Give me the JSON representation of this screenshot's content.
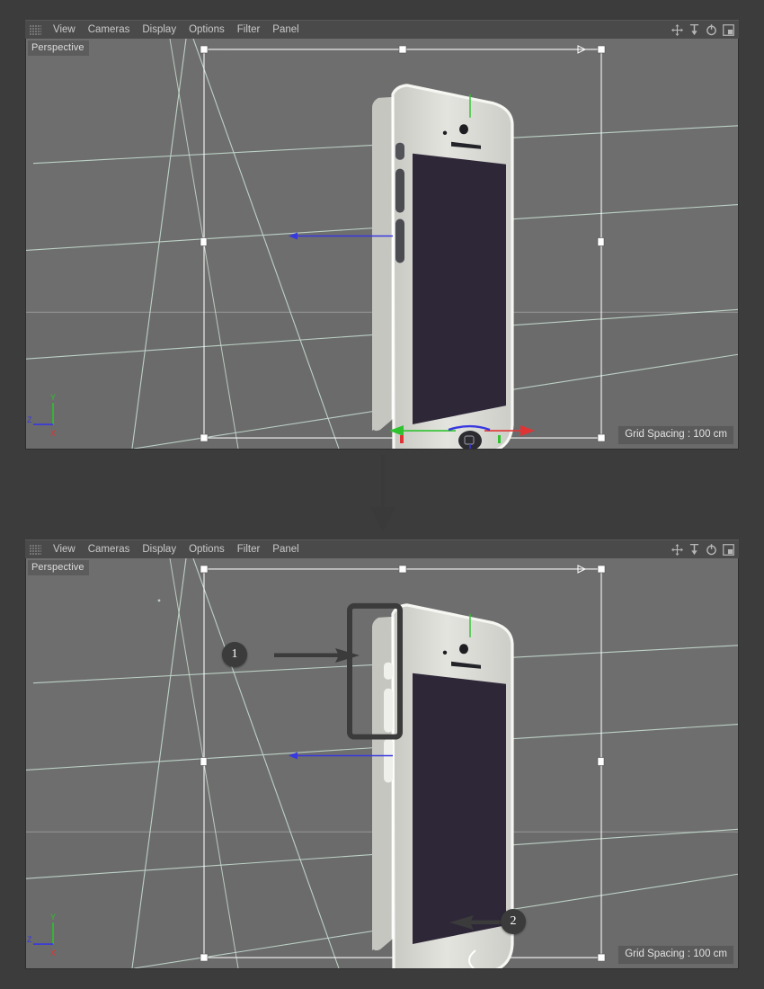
{
  "app": {
    "background_color": "#3c3c3c",
    "toolbar_color": "#4a4a4a",
    "viewport_color": "#6e6e6e",
    "grid_color": "#c5dcd0",
    "accent_x_color": "#e03434",
    "accent_y_color": "#2ec22e",
    "accent_z_color": "#3838e0",
    "screen_color": "#2e2738",
    "body_color": "#d8d8d4",
    "highlight_color": "#3b3b3b"
  },
  "toolbar": {
    "grip_icon": "grip-dots-icon",
    "menu_items": [
      {
        "label": "View"
      },
      {
        "label": "Cameras"
      },
      {
        "label": "Display"
      },
      {
        "label": "Options"
      },
      {
        "label": "Filter"
      },
      {
        "label": "Panel"
      }
    ],
    "right_icons": [
      {
        "name": "move-tool-icon",
        "title": "Move"
      },
      {
        "name": "scale-tool-icon",
        "title": "Scale"
      },
      {
        "name": "rotate-tool-icon",
        "title": "Rotate"
      },
      {
        "name": "maximize-panel-icon",
        "title": "Maximize Panel"
      }
    ]
  },
  "viewports": [
    {
      "id": "top",
      "label": "Perspective",
      "grid_spacing": "Grid Spacing : 100 cm",
      "axis_gizmo": {
        "x": "X",
        "y": "Y",
        "z": "Z"
      },
      "state": "before",
      "description": "Phone model with dark side buttons and dark home button"
    },
    {
      "id": "bottom",
      "label": "Perspective",
      "grid_spacing": "Grid Spacing : 100 cm",
      "axis_gizmo": {
        "x": "X",
        "y": "Y",
        "z": "Z"
      },
      "state": "after",
      "description": "Phone model with light side buttons and outlined home button"
    }
  ],
  "callouts": [
    {
      "number": "1",
      "target": "side-buttons-region"
    },
    {
      "number": "2",
      "target": "home-button-region"
    }
  ],
  "transition": {
    "direction": "down",
    "icon": "down-arrow-icon"
  }
}
